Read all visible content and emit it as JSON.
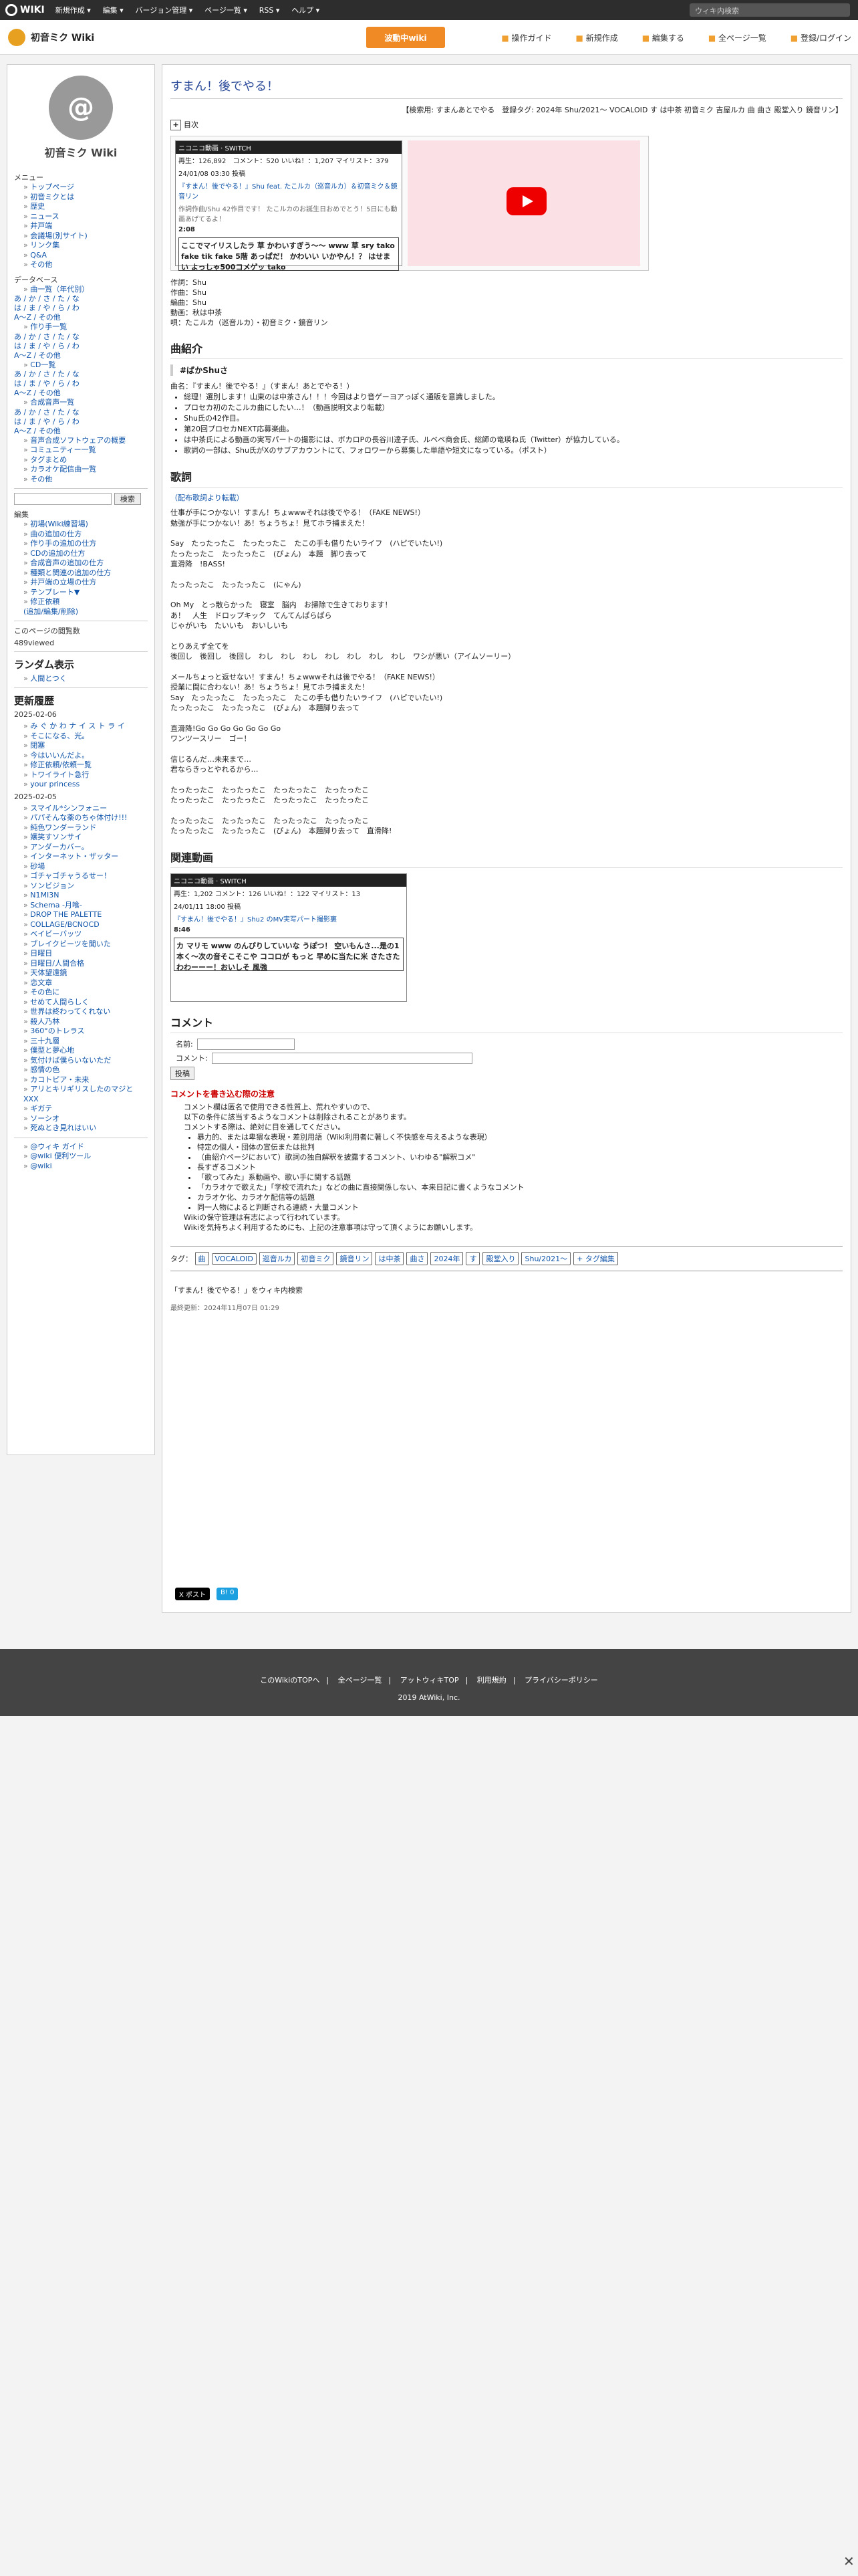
{
  "topbar": {
    "logo": "WIKI",
    "menus": [
      "新規作成 ▾",
      "編集 ▾",
      "バージョン管理 ▾",
      "ページ一覧 ▾",
      "RSS ▾",
      "ヘルプ ▾"
    ],
    "search_placeholder": "ウィキ内検索"
  },
  "subbar": {
    "wiki_name": "初音ミク Wiki",
    "start_btn": "波動中wiki",
    "tools": [
      "操作ガイド",
      "新規作成",
      "編集する",
      "全ページ一覧",
      "登録/ログイン"
    ]
  },
  "sidebar": {
    "wiki_title": "初音ミク Wiki",
    "menu_head": "メニュー",
    "menu": [
      "トップページ",
      "初音ミクとは",
      "歴史",
      "ニュース",
      "井戸端",
      "会議場(別サイト)",
      "リンク集",
      "Q&A",
      "その他"
    ],
    "db_head": "データベース",
    "db_items": [
      "曲一覧（年代別）"
    ],
    "kana": [
      "あ / か / さ / た / な",
      "は / ま / や / ら / わ",
      "A〜Z / その他"
    ],
    "db_items2": [
      "作り手一覧",
      "CD一覧",
      "合成音声一覧"
    ],
    "db_items3": [
      "音声合成ソフトウェアの概要",
      "コミュニティー一覧",
      "タグまとめ",
      "カラオケ配信曲一覧",
      "その他"
    ],
    "search_btn": "検索",
    "edit_head": "編集",
    "edit_items": [
      "初場(Wiki練習場)",
      "曲の追加の仕方",
      "作り手の追加の仕方",
      "CDの追加の仕方",
      "合成音声の追加の仕方",
      "種類と関連の追加の仕方",
      "井戸端の立場の仕方",
      "テンプレート▼",
      "修正依頼"
    ],
    "edit_extra": "(追加/編集/削除)",
    "count_label": "このページの閲覧数",
    "count": "489viewed",
    "random_head": "ランダム表示",
    "random_item": "人間とつく",
    "updates_head": "更新履歴",
    "date1": "2025-02-06",
    "updates1": [
      "み ぐ か わ ナ イ ス ト ラ イ",
      "そこになる、光。",
      "閉塞",
      "今はいいんだよ。",
      "修正依頼/依頼一覧",
      "トワイライト急行",
      "your princess"
    ],
    "date2": "2025-02-05",
    "updates2": [
      "スマイル*シンフォニー",
      "パパそんな薬のちゃ体付け!!!",
      "純色ワンダーランド",
      "嬢笑すソンサイ",
      "アンダーカバー。",
      "インターネット・ザッター",
      "砂場",
      "ゴチャゴチャうるせー！",
      "ソンビジョン",
      "N1MI3N",
      "Schema -月喰-",
      "DROP THE PALETTE",
      "COLLAGE/BCNOCD",
      "ベイビーバッツ",
      "ブレイクビーツを聞いた",
      "日曜日",
      "日曜日/人間合格",
      "天体望遠鏡",
      "恋文章",
      "その色に",
      "せめて人間らしく",
      "世界は終わってくれない",
      "殺人乃林",
      "360°のトレラス",
      "三十九層",
      "僕型と夢心地",
      "気付けば僕らいないただ",
      "感情の色",
      "カコトピア・未来",
      "アリとキリギリスしたのマジとXXX",
      "ギガテ",
      "ソーシオ",
      "死ぬとき見れはいい"
    ],
    "bottom_items": [
      "@ウィキ ガイド",
      "@wiki 便利ツール",
      "@wiki"
    ]
  },
  "main": {
    "title": "すまん！後でやる！",
    "tagline": "【検索用: すまんあとでやる　登録タグ: 2024年 Shu/2021〜 VOCALOID す は中茶 初音ミク 吉屋ルカ 曲 曲さ 殿堂入り 鏡音リン】",
    "toc": "目次",
    "nico1": {
      "header": "ニコニコ動画 · SWITCH",
      "stats": "再生：126,892　コメント：520 いいね！：1,207 マイリスト：379",
      "date": "24/01/08 03:30 投稿",
      "link": "『すまん！後でやる！』Shu feat. たこルカ（巡音ルカ）＆初音ミク＆鏡音リン",
      "desc": "作詞作曲/Shu 42作目です！ たこルカのお誕生日おめでとう！5日にも動画あげてるよ！",
      "duration": "2:08",
      "comment": "ここでマイリスしたラ 草 かわいすぎう〜〜 www 草 sry tako fake tik fake 5階 あっぱだ！ かわいい いかやん！？ はせまい よっしゃ500コメゲッ tako"
    },
    "credits": [
      "作詞：Shu",
      "作曲：Shu",
      "編曲：Shu",
      "動画：秋は中茶",
      "唄：たこルカ（巡音ルカ）・初音ミク・鏡音リン"
    ],
    "intro_head": "曲紹介",
    "quote": "#ばかShuさ",
    "intro_lines": [
      "曲名：『すまん！後でやる！』（すまん！あとでやる！）",
      "総理！選別します！山東のは中茶さん！！！今回はより音ゲーヨアっぽく通販を意識しました。",
      "プロセカ初のたこルカ曲にしたい…！（動画説明文より転載）",
      "Shu氏の42作目。",
      "第20回プロセカNEXT応募楽曲。",
      "は中茶氏による動画の実写パートの撮影には、ボカロPの長谷川達子氏、ルベベ商会氏、総師の竜瑛ね氏（Twitter）が協力している。",
      "歌詞の一部は、Shu氏がXのサブアカウントにて、フォロワーから募集した単語や短文になっている。（ポスト）"
    ],
    "lyric_head": "歌詞",
    "lyric_src": "（配布歌詞より転載）",
    "lyrics": [
      "仕事が手につかない！すまん！ちょwwwそれは後でやる！（FAKE NEWS!）\n勉強が手につかない！あ！ちょうちょ！見てホラ捕まえた！",
      "Say　たったったこ　たったったこ　たこの手も借りたいライフ　(ハピでいたい!)\nたったったこ　たったったこ　(ぴょん)　本題　脚り去って\n直滑降　!BASS!",
      "たったったこ　たったったこ　(にゃん)",
      "Oh My　とっ散らかった　寝室　脳内　お掃除で生きております！\nあ！　人生　ドロップキック　てんてんぱらぱら\nじゃがいも　たいいも　おいしいも",
      "とりあえず全てを\n後回し　後回し　後回し　わし　わし　わし　わし　わし　わし　わし　ワシが悪い（アイムソーリー）",
      "メールちょっと返せない！すまん！ちょwwwそれは後でやる！（FAKE NEWS!）\n授業に間に合わない！あ！ちょうちょ！見てホラ捕まえた！\nSay　たったったこ　たったったこ　たこの手も借りたいライフ　(ハピでいたい!)\nたったったこ　たったったこ　(ぴょん)　本題脚り去って",
      "直滑降!Go Go Go Go Go Go Go\nワンツースリー　ゴー！",
      "信じるんだ…未来まで…\n君ならきっとやれるから…",
      "たったったこ　たったったこ　たったったこ　たったったこ\nたったったこ　たったったこ　たったったこ　たったったこ",
      "たったったこ　たったったこ　たったったこ　たったったこ\nたったったこ　たったったこ　(ぴょん)　本題脚り去って　直滑降!"
    ],
    "related_head": "関連動画",
    "nico2": {
      "header": "ニコニコ動画 · SWITCH",
      "stats": "再生：1,202 コメント：126 いいね！：122 マイリスト：13",
      "date": "24/01/11 18:00 投稿",
      "link": "『すまん！後でやる！』Shu2 のMV実写パート撮影裏",
      "duration": "8:46",
      "comment": "カ マリモ www のんびりしていいな うぽつ！ 空いもんさ...是の1本く〜次の音そこそこや ココロが もっと 早めに当たに米 さたさた わわーーー！おいしそ 風強"
    },
    "comment_head": "コメント",
    "name_label": "名前:",
    "comment_label": "コメント:",
    "post_btn": "投稿",
    "notice_head": "コメントを書き込む際の注意",
    "notice_lines": [
      "コメント欄は匿名で使用できる性質上、荒れやすいので、",
      "以下の条件に該当するようなコメントは削除されることがあります。",
      "コメントする際は、絶対に目を通してください。"
    ],
    "notice_items": [
      "暴力的、または卑猥な表現・差別用語（Wiki利用者に著しく不快感を与えるような表現）",
      "特定の個人・団体の宣伝または批判",
      "（曲紹介ページにおいて）歌詞の独自解釈を披露するコメント、いわゆる\"解釈コメ\"",
      "長すぎるコメント",
      "「歌ってみた」系動画や、歌い手に関する話題",
      "「カラオケで歌えた」「学校で流れた」などの曲に直接関係しない、本来日記に書くようなコメント",
      "カラオケ化、カラオケ配信等の話題",
      "同一人物によると判断される連続・大量コメント"
    ],
    "notice_tail": [
      "Wikiの保守管理は有志によって行われています。",
      "Wikiを気持ちよく利用するためにも、上記の注意事項は守って頂くようにお願いします。"
    ],
    "tags_label": "タグ：",
    "tags": [
      "曲",
      "VOCALOID",
      "巡音ルカ",
      "初音ミク",
      "鏡音リン",
      "は中茶",
      "曲さ",
      "2024年",
      "す",
      "殿堂入り",
      "Shu/2021〜",
      "+ タグ編集"
    ],
    "search_link": "「すまん！後でやる！」をウィキ内検索",
    "updated": "最終更新：2024年11月07日 01:29",
    "share": [
      "X ポスト",
      "B! 0"
    ]
  },
  "footer": {
    "links": [
      "このWikiのTOPへ",
      "全ページ一覧",
      "アットウィキTOP",
      "利用規約",
      "プライバシーポリシー"
    ],
    "copyright": "2019 AtWiki, Inc."
  }
}
